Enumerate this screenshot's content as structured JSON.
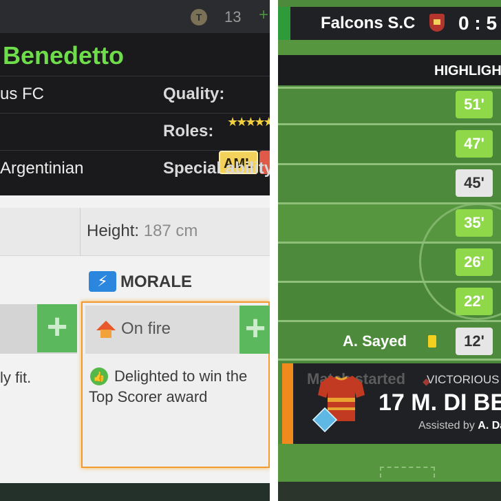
{
  "left_panel": {
    "topbar": {
      "coin_symbol": "T",
      "coin_count": "13",
      "add_symbol": "+"
    },
    "player": {
      "name": "Benedetto",
      "club": "us FC",
      "quality_label": "Quality:",
      "quality_stars": "★★★★★",
      "roles_label": "Roles:",
      "role_primary": "AML",
      "nationality": "Argentinian",
      "special_ability_label": "Special ability"
    },
    "stats": {
      "height_label": "Height:",
      "height_value": "187 cm"
    },
    "fitness": {
      "add_symbol": "+",
      "status_text": "ly fit."
    },
    "morale": {
      "icon_symbol": "⚡",
      "title": "MORALE",
      "status": "On fire",
      "add_symbol": "+",
      "reason_icon": "👍",
      "reason_line1": "Delighted to win the",
      "reason_line2": "Top Scorer award"
    }
  },
  "right_panel": {
    "scoreboard": {
      "team": "Falcons S.C",
      "score": "0 : 5"
    },
    "highlights": {
      "title": "HIGHLIGHT",
      "minutes": [
        "51'",
        "47'",
        "45'",
        "35'",
        "26'",
        "22'",
        "12'"
      ],
      "booking_player": "A. Sayed"
    },
    "event": {
      "match_started": "Match started",
      "victorious": "VICTORIOUS",
      "scorer": "17 M. DI BE",
      "assist_label": "Assisted by",
      "assist_player": "A. Da"
    }
  },
  "colors": {
    "player_name": "#6fdc4c",
    "minute_highlight": "#8fd84a",
    "minute_neutral": "#e6e6e6",
    "pitch": "#4d8a3b",
    "morale_border": "#f39a2e",
    "event_accent": "#f08a1e"
  }
}
